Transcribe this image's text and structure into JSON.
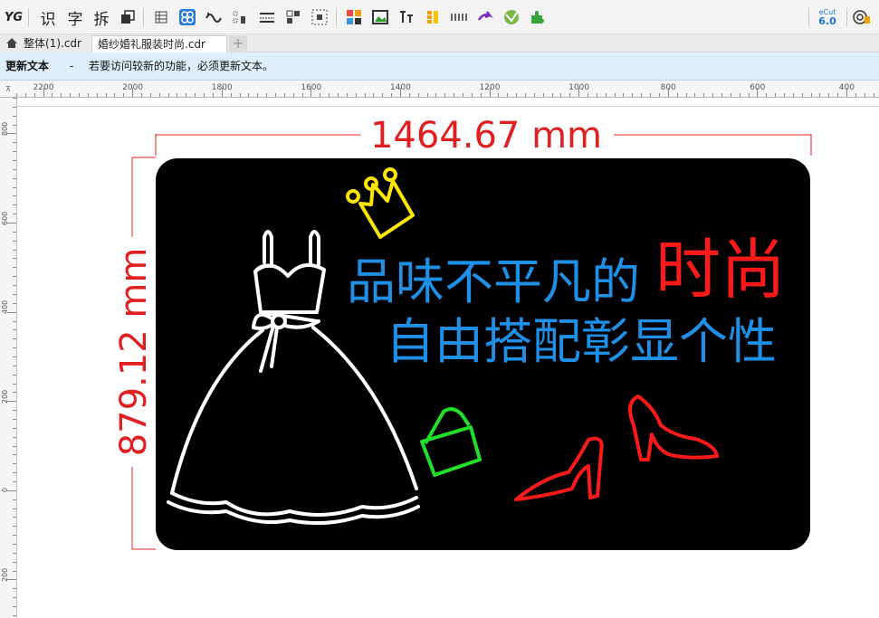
{
  "toolbar": {
    "logo": "YG",
    "btn_recognize": "识",
    "btn_char": "字",
    "btn_split": "拆",
    "ecut_label": "eCut",
    "ecut_version": "6.0",
    "icons": [
      "layers-icon",
      "table-icon",
      "node-icon",
      "curve-icon",
      "align-icon",
      "distribute-icon",
      "group-icon",
      "select-icon",
      "color-icon",
      "image-icon",
      "text-icon",
      "fill-icon",
      "grid-icon",
      "arrow-icon",
      "globe-icon",
      "puzzle-icon",
      "ecut-icon",
      "settings-icon"
    ]
  },
  "tabs": {
    "tab1": "整体(1).cdr",
    "tab2": "婚纱婚礼服装时尚.cdr",
    "add": "+"
  },
  "notice": {
    "title": "更新文本",
    "dash": "-",
    "message": "若要访问较新的功能，必须更新文本。"
  },
  "ruler": {
    "h_labels": [
      "2200",
      "2000",
      "1800",
      "1600",
      "1400",
      "1200",
      "1000",
      "800",
      "600",
      "400"
    ],
    "v_labels": [
      "800",
      "600",
      "400",
      "200",
      "0",
      "200"
    ],
    "corner": "⊼"
  },
  "design": {
    "width_dim": "1464.67 mm",
    "height_dim": "879.12 mm",
    "line1_blue": "品味不平凡的",
    "line1_red": "时尚",
    "line2": "自由搭配彰显个性",
    "colors": {
      "board": "#000000",
      "dim": "#e02020",
      "blue_text": "#1e90e8",
      "red_text": "#ff1a1a",
      "white": "#ffffff",
      "yellow": "#ffe600",
      "green": "#22e02a",
      "red_shoe": "#ff1a1a"
    }
  }
}
